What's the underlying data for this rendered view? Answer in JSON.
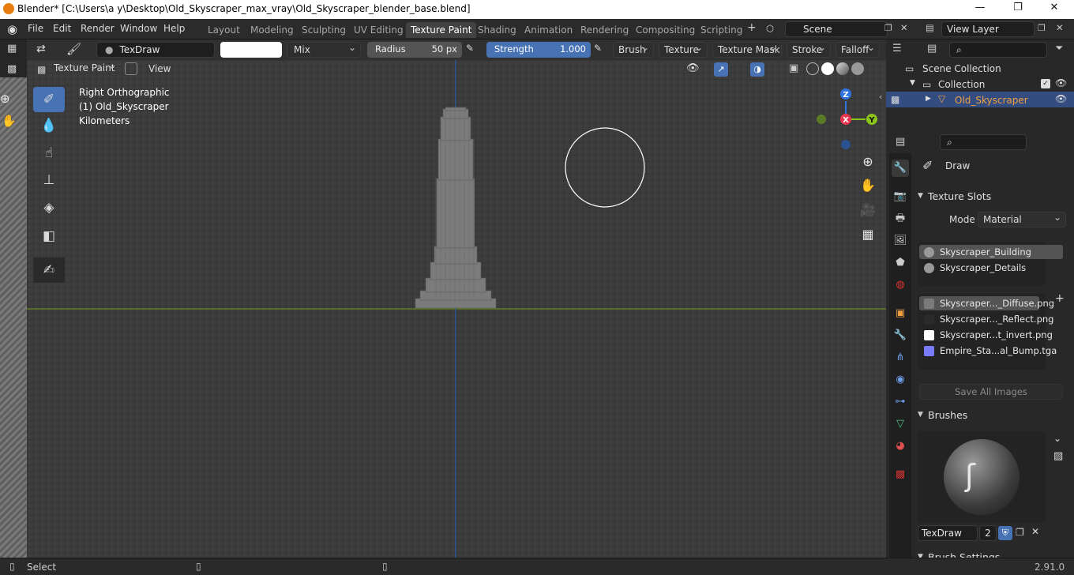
{
  "window": {
    "title": "Blender* [C:\\Users\\a y\\Desktop\\Old_Skyscraper_max_vray\\Old_Skyscraper_blender_base.blend]",
    "min": "—",
    "max": "❐",
    "close": "✕"
  },
  "menu": [
    "File",
    "Edit",
    "Render",
    "Window",
    "Help"
  ],
  "workspaces": [
    "Layout",
    "Modeling",
    "Sculpting",
    "UV Editing",
    "Texture Paint",
    "Shading",
    "Animation",
    "Rendering",
    "Compositing",
    "Scripting"
  ],
  "active_workspace": "Texture Paint",
  "scene": {
    "name": "Scene",
    "view_layer": "View Layer"
  },
  "tool_settings": {
    "brush_name": "TexDraw",
    "blend_mode": "Mix",
    "radius_label": "Radius",
    "radius_value": "50 px",
    "strength_label": "Strength",
    "strength_value": "1.000",
    "strength_fraction": 1.0,
    "menus": [
      "Brush",
      "Texture",
      "Texture Mask",
      "Stroke",
      "Falloff"
    ]
  },
  "viewport_header": {
    "mode": "Texture Paint",
    "view": "View"
  },
  "viewport_overlay": {
    "line1": "Right Orthographic",
    "line2": "(1) Old_Skyscraper",
    "line3": "Kilometers"
  },
  "gizmo": {
    "z": "Z",
    "x": "X",
    "y": "Y"
  },
  "outliner": {
    "scene_collection": "Scene Collection",
    "collection": "Collection",
    "object": "Old_Skyscraper"
  },
  "properties": {
    "active_tool": "Draw",
    "texture_slots_header": "Texture Slots",
    "mode_label": "Mode",
    "mode_value": "Material",
    "materials": [
      "Skyscraper_Building",
      "Skyscraper_Details"
    ],
    "images": [
      "Skyscraper..._Diffuse.png",
      "Skyscraper..._Reflect.png",
      "Skyscraper...t_invert.png",
      "Empire_Sta...al_Bump.tga"
    ],
    "image_colors": [
      "#7a7a7a",
      "#2a2a2a",
      "#ffffff",
      "#7b7bff"
    ],
    "save_all": "Save All Images",
    "brushes_header": "Brushes",
    "brush_name": "TexDraw",
    "brush_users": "2",
    "brush_settings_header": "Brush Settings"
  },
  "status": {
    "left": "Select",
    "version": "2.91.0"
  },
  "colors": {
    "accent": "#4772b3",
    "x_axis": "#e8344e",
    "y_axis": "#8bc51a",
    "z_axis": "#2f74e3",
    "horizon": "#6b8a1e",
    "vertical": "#2b5fa8"
  }
}
